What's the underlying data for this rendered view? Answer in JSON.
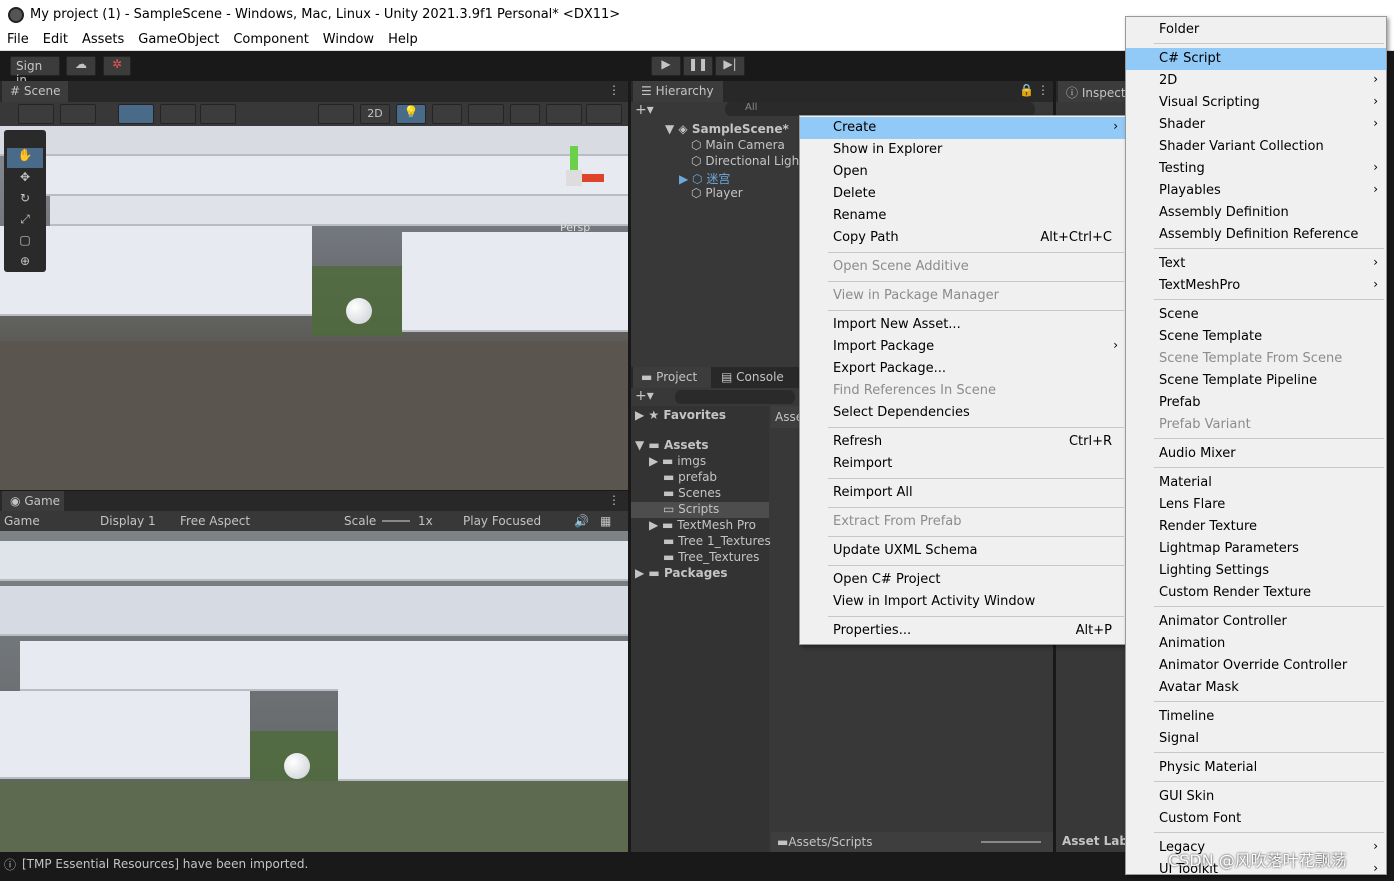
{
  "window": {
    "title": "My project (1) - SampleScene - Windows, Mac, Linux - Unity 2021.3.9f1 Personal* <DX11>"
  },
  "menubar": [
    "File",
    "Edit",
    "Assets",
    "GameObject",
    "Component",
    "Window",
    "Help"
  ],
  "toolbar": {
    "sign_in": "Sign in"
  },
  "scene": {
    "tab": "Scene",
    "mode_2d": "2D",
    "persp": "Persp"
  },
  "game": {
    "tab": "Game",
    "game_dropdown": "Game",
    "display": "Display 1",
    "aspect": "Free Aspect",
    "scale_label": "Scale",
    "scale_value": "1x",
    "play_focused": "Play Focused"
  },
  "hierarchy": {
    "tab": "Hierarchy",
    "search_placeholder": "All",
    "items": [
      {
        "label": "SampleScene*",
        "level": 0
      },
      {
        "label": "Main Camera",
        "level": 1
      },
      {
        "label": "Directional Light",
        "level": 1
      },
      {
        "label": "迷宫",
        "level": 1
      },
      {
        "label": "Player",
        "level": 1
      }
    ]
  },
  "inspector": {
    "tab": "Inspector",
    "asset_labels": "Asset Lab"
  },
  "project": {
    "tab_project": "Project",
    "tab_console": "Console",
    "favorites": "Favorites",
    "assets": "Assets",
    "folders": [
      "imgs",
      "prefab",
      "Scenes",
      "Scripts",
      "TextMesh Pro",
      "Tree 1_Textures",
      "Tree_Textures"
    ],
    "packages": "Packages",
    "breadcrumb": "Assets/Scripts",
    "right_header": "Asse"
  },
  "context_menu": {
    "items": [
      {
        "label": "Create",
        "shortcut": "",
        "highlight": true,
        "arrow": true
      },
      {
        "label": "Show in Explorer",
        "shortcut": ""
      },
      {
        "label": "Open",
        "shortcut": ""
      },
      {
        "label": "Delete",
        "shortcut": ""
      },
      {
        "label": "Rename",
        "shortcut": ""
      },
      {
        "label": "Copy Path",
        "shortcut": "Alt+Ctrl+C"
      },
      {
        "label": "Open Scene Additive",
        "shortcut": "",
        "disabled": true
      },
      {
        "label": "View in Package Manager",
        "shortcut": "",
        "disabled": true
      },
      {
        "label": "Import New Asset...",
        "shortcut": ""
      },
      {
        "label": "Import Package",
        "shortcut": "",
        "arrow": true
      },
      {
        "label": "Export Package...",
        "shortcut": ""
      },
      {
        "label": "Find References In Scene",
        "shortcut": "",
        "disabled": true
      },
      {
        "label": "Select Dependencies",
        "shortcut": ""
      },
      {
        "label": "Refresh",
        "shortcut": "Ctrl+R"
      },
      {
        "label": "Reimport",
        "shortcut": ""
      },
      {
        "label": "Reimport All",
        "shortcut": ""
      },
      {
        "label": "Extract From Prefab",
        "shortcut": "",
        "disabled": true
      },
      {
        "label": "Update UXML Schema",
        "shortcut": ""
      },
      {
        "label": "Open C# Project",
        "shortcut": ""
      },
      {
        "label": "View in Import Activity Window",
        "shortcut": ""
      },
      {
        "label": "Properties...",
        "shortcut": "Alt+P"
      }
    ]
  },
  "create_submenu": {
    "items": [
      {
        "label": "Folder"
      },
      {
        "label": "C# Script",
        "highlight": true
      },
      {
        "label": "2D",
        "arrow": true
      },
      {
        "label": "Visual Scripting",
        "arrow": true
      },
      {
        "label": "Shader",
        "arrow": true
      },
      {
        "label": "Shader Variant Collection"
      },
      {
        "label": "Testing",
        "arrow": true
      },
      {
        "label": "Playables",
        "arrow": true
      },
      {
        "label": "Assembly Definition"
      },
      {
        "label": "Assembly Definition Reference"
      },
      {
        "label": "Text",
        "arrow": true
      },
      {
        "label": "TextMeshPro",
        "arrow": true
      },
      {
        "label": "Scene"
      },
      {
        "label": "Scene Template"
      },
      {
        "label": "Scene Template From Scene",
        "disabled": true
      },
      {
        "label": "Scene Template Pipeline"
      },
      {
        "label": "Prefab"
      },
      {
        "label": "Prefab Variant",
        "disabled": true
      },
      {
        "label": "Audio Mixer"
      },
      {
        "label": "Material"
      },
      {
        "label": "Lens Flare"
      },
      {
        "label": "Render Texture"
      },
      {
        "label": "Lightmap Parameters"
      },
      {
        "label": "Lighting Settings"
      },
      {
        "label": "Custom Render Texture"
      },
      {
        "label": "Animator Controller"
      },
      {
        "label": "Animation"
      },
      {
        "label": "Animator Override Controller"
      },
      {
        "label": "Avatar Mask"
      },
      {
        "label": "Timeline"
      },
      {
        "label": "Signal"
      },
      {
        "label": "Physic Material"
      },
      {
        "label": "GUI Skin"
      },
      {
        "label": "Custom Font"
      },
      {
        "label": "Legacy",
        "arrow": true
      },
      {
        "label": "UI Toolkit",
        "arrow": true
      }
    ]
  },
  "status": {
    "message": "[TMP Essential Resources] have been imported."
  },
  "watermark": "CSDN @风吹落叶花飘荡",
  "colors": {
    "highlight": "#91c9f7",
    "panel": "#383838",
    "header": "#282828"
  }
}
